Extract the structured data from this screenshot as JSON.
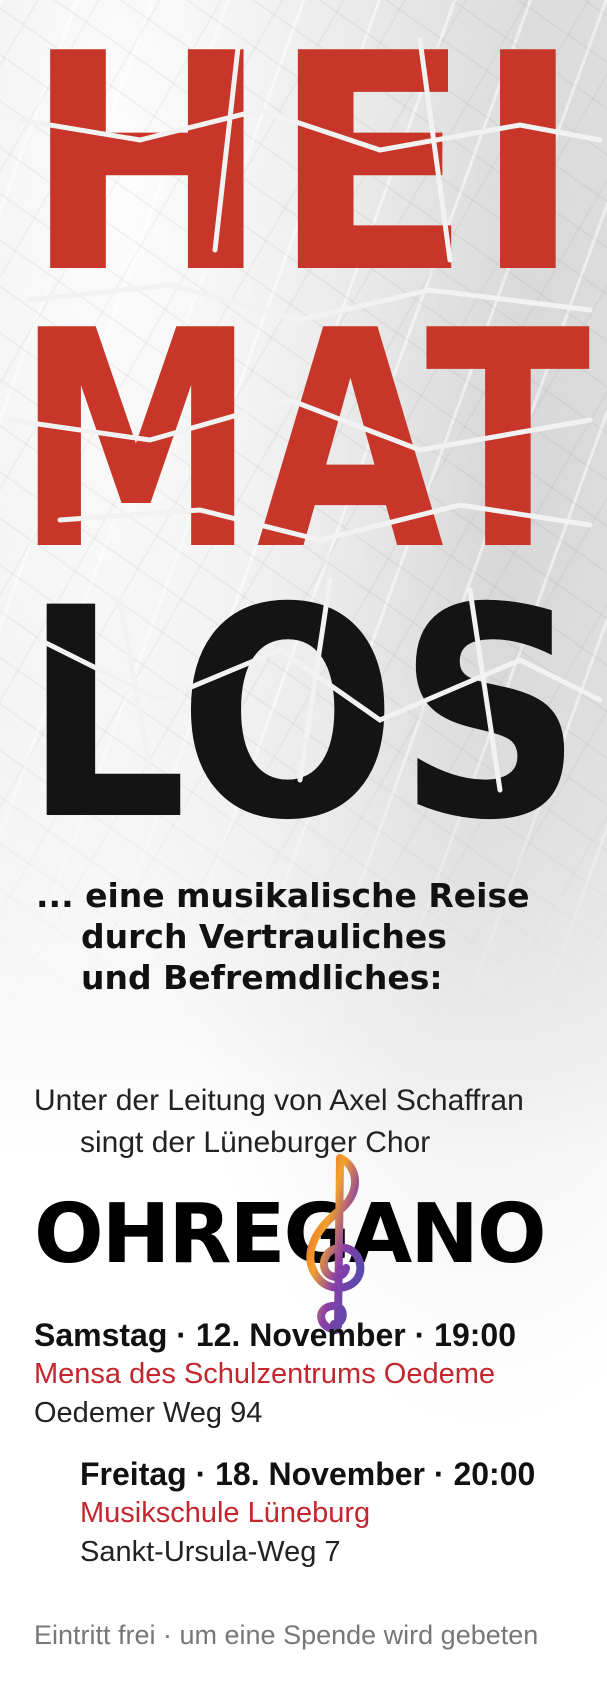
{
  "title": {
    "line1": "HEI",
    "line2": "MAT",
    "line3": "LOS",
    "red": "#c73628",
    "black": "#141414"
  },
  "tagline": {
    "line1": "... eine musikalische Reise",
    "line2": "durch Vertrauliches",
    "line3": "und Befremdliches:"
  },
  "intro": {
    "line1": "Unter der Leitung von Axel Schaffran",
    "line2": "singt der Lüneburger Chor"
  },
  "choir_name": "OHREGANO",
  "events": [
    {
      "date": "Samstag · 12. November · 19:00",
      "venue": "Mensa des Schulzentrums Oedeme",
      "address": "Oedemer Weg 94"
    },
    {
      "date": "Freitag · 18. November · 20:00",
      "venue": "Musikschule Lüneburg",
      "address": "Sankt-Ursula-Weg 7"
    }
  ],
  "footer": "Eintritt frei · um eine Spende wird gebeten",
  "colors": {
    "accent_red": "#c4262e",
    "text": "#111111"
  },
  "icons": {
    "clef": "treble-clef-icon"
  }
}
